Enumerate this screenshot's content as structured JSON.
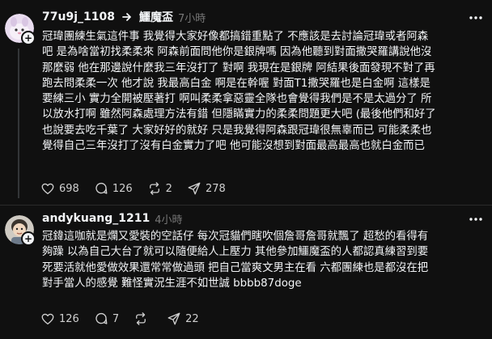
{
  "posts": [
    {
      "username": "77u9j_1108",
      "replied_to": "鱷魔盃",
      "time": "7小時",
      "lines": [
        "冠瑋團練生氣這件事 我覺得大家好像都搞錯重點了 不應該是去討論冠瑋或者阿森",
        "吧 是為啥當初找柔柔來 阿森前面問他你是銀牌嗎 因為他聽到對面撒哭羅講說他沒",
        "那麼弱 他在那邊說什麼我三年沒打了 對啊 我現在是銀牌 阿結果後面發現不對了再",
        "跑去問柔柔一次 他才說 我最高白金 啊是在幹喔 對面T1撒哭羅也是白金啊 這樣是",
        "要練三小 實力全開被壓著打 啊叫柔柔拿惡靈全隊也會覺得我們是不是太過分了 所",
        "以放水打啊 雖然阿森處理方法有錯 但隱瞞實力的柔柔問題更大吧 (最後他們和好了",
        "也說要去吃千葉了 大家好好的就好 只是我覺得阿森跟冠瑋很無辜而已 可能柔柔也",
        "覺得自己三年沒打了沒有白金實力了吧 他可能沒想到對面最高最高也就白金而已"
      ],
      "likes": "698",
      "comments": "126",
      "reposts": "2",
      "shares": "278"
    },
    {
      "username": "andykuang_1211",
      "time": "4小時",
      "lines": [
        "冠鍏這咖就是爛又愛裝的空話仔 每次冠貓們瞎吹個詹哥詹哥就飄了 超愁的看得有",
        "夠躁 以為自己大台了就可以隨便給人上壓力 其他參加鱷魔盃的人都認真練習到要",
        "死要活就他愛做效果還常常做過頭 把自己當爽文男主在看 六都團練也是都沒在把",
        "對手當人的感覺 難怪實況生涯不如世誠 bbbb87doge"
      ],
      "likes": "126",
      "comments": "7",
      "reposts": "",
      "shares": "22"
    }
  ],
  "icons": {
    "like": "heart-icon",
    "comment": "comment-bubble-icon",
    "repost": "repost-arrows-icon",
    "share": "paper-plane-icon",
    "reply_indicator": "reply-arrow-icon",
    "more": "more-dots-icon",
    "follow": "plus-icon"
  },
  "colors": {
    "background": "#101010",
    "text": "#f3f5f7",
    "muted": "#777777",
    "divider": "#2a2a2a"
  }
}
